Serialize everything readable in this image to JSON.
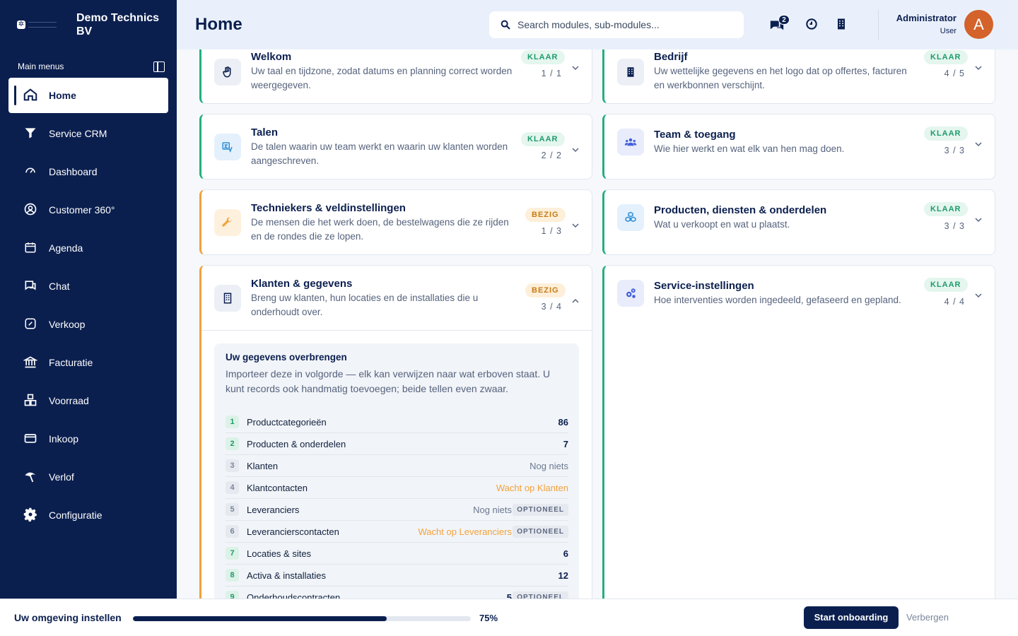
{
  "brand": {
    "name": "Demo Technics BV"
  },
  "sidebar": {
    "section_label": "Main menus",
    "items": [
      {
        "label": "Home",
        "icon": "home-icon",
        "active": true
      },
      {
        "label": "Service CRM",
        "icon": "filter-icon"
      },
      {
        "label": "Dashboard",
        "icon": "gauge-icon"
      },
      {
        "label": "Customer 360°",
        "icon": "user-circle-icon"
      },
      {
        "label": "Agenda",
        "icon": "calendar-icon"
      },
      {
        "label": "Chat",
        "icon": "chat-icon"
      },
      {
        "label": "Verkoop",
        "icon": "percent-icon"
      },
      {
        "label": "Facturatie",
        "icon": "bank-icon"
      },
      {
        "label": "Voorraad",
        "icon": "boxes-icon"
      },
      {
        "label": "Inkoop",
        "icon": "card-icon"
      },
      {
        "label": "Verlof",
        "icon": "leave-icon"
      },
      {
        "label": "Configuratie",
        "icon": "gear-icon"
      }
    ]
  },
  "header": {
    "title": "Home",
    "search_placeholder": "Search modules, sub-modules...",
    "chat_badge": "2",
    "user_name": "Administrator",
    "user_role": "User",
    "avatar_letter": "A"
  },
  "cards": {
    "welkom": {
      "title": "Welkom",
      "desc": "Uw taal en tijdzone, zodat datums en planning correct worden weergegeven.",
      "status": "KLAAR",
      "count": "1 / 1"
    },
    "bedrijf": {
      "title": "Bedrijf",
      "desc": "Uw wettelijke gegevens en het logo dat op offertes, facturen en werkbonnen verschijnt.",
      "status": "KLAAR",
      "count": "4 / 5"
    },
    "talen": {
      "title": "Talen",
      "desc": "De talen waarin uw team werkt en waarin uw klanten worden aangeschreven.",
      "status": "KLAAR",
      "count": "2 / 2"
    },
    "team": {
      "title": "Team & toegang",
      "desc": "Wie hier werkt en wat elk van hen mag doen.",
      "status": "KLAAR",
      "count": "3 / 3"
    },
    "techniekers": {
      "title": "Techniekers & veldinstellingen",
      "desc": "De mensen die het werk doen, de bestelwagens die ze rijden en de rondes die ze lopen.",
      "status": "BEZIG",
      "count": "1 / 3"
    },
    "producten": {
      "title": "Producten, diensten & onderdelen",
      "desc": "Wat u verkoopt en wat u plaatst.",
      "status": "KLAAR",
      "count": "3 / 3"
    },
    "klanten": {
      "title": "Klanten & gegevens",
      "desc": "Breng uw klanten, hun locaties en de installaties die u onderhoudt over.",
      "status": "BEZIG",
      "count": "3 / 4"
    },
    "service": {
      "title": "Service-instellingen",
      "desc": "Hoe interventies worden ingedeeld, gefaseerd en gepland.",
      "status": "KLAAR",
      "count": "4 / 4"
    }
  },
  "import_panel": {
    "title": "Uw gegevens overbrengen",
    "desc": "Importeer deze in volgorde — elk kan verwijzen naar wat erboven staat. U kunt records ook handmatig toevoegen; beide tellen even zwaar.",
    "optional_label": "OPTIONEEL",
    "steps": [
      {
        "num": "1",
        "name": "Productcategorieën",
        "value": "86",
        "style": "bold",
        "done": true
      },
      {
        "num": "2",
        "name": "Producten & onderdelen",
        "value": "7",
        "style": "bold",
        "done": true
      },
      {
        "num": "3",
        "name": "Klanten",
        "value": "Nog niets",
        "style": "muted",
        "done": false
      },
      {
        "num": "4",
        "name": "Klantcontacten",
        "value": "Wacht op Klanten",
        "style": "warn",
        "done": false
      },
      {
        "num": "5",
        "name": "Leveranciers",
        "value": "Nog niets",
        "style": "muted",
        "done": false,
        "optional": true
      },
      {
        "num": "6",
        "name": "Leverancierscontacten",
        "value": "Wacht op Leveranciers",
        "style": "warn",
        "done": false,
        "optional": true
      },
      {
        "num": "7",
        "name": "Locaties & sites",
        "value": "6",
        "style": "bold",
        "done": true
      },
      {
        "num": "8",
        "name": "Activa & installaties",
        "value": "12",
        "style": "bold",
        "done": true
      },
      {
        "num": "9",
        "name": "Onderhoudscontracten",
        "value": "5",
        "style": "bold",
        "done": true,
        "optional": true
      }
    ]
  },
  "footer": {
    "title": "Uw omgeving instellen",
    "progress_pct": 75,
    "progress_label": "75%",
    "start_label": "Start onboarding",
    "hide_label": "Verbergen"
  },
  "colors": {
    "navy": "#0b1f4f",
    "done": "#22b07d",
    "busy": "#f2a23b",
    "avatar": "#d3622b"
  }
}
